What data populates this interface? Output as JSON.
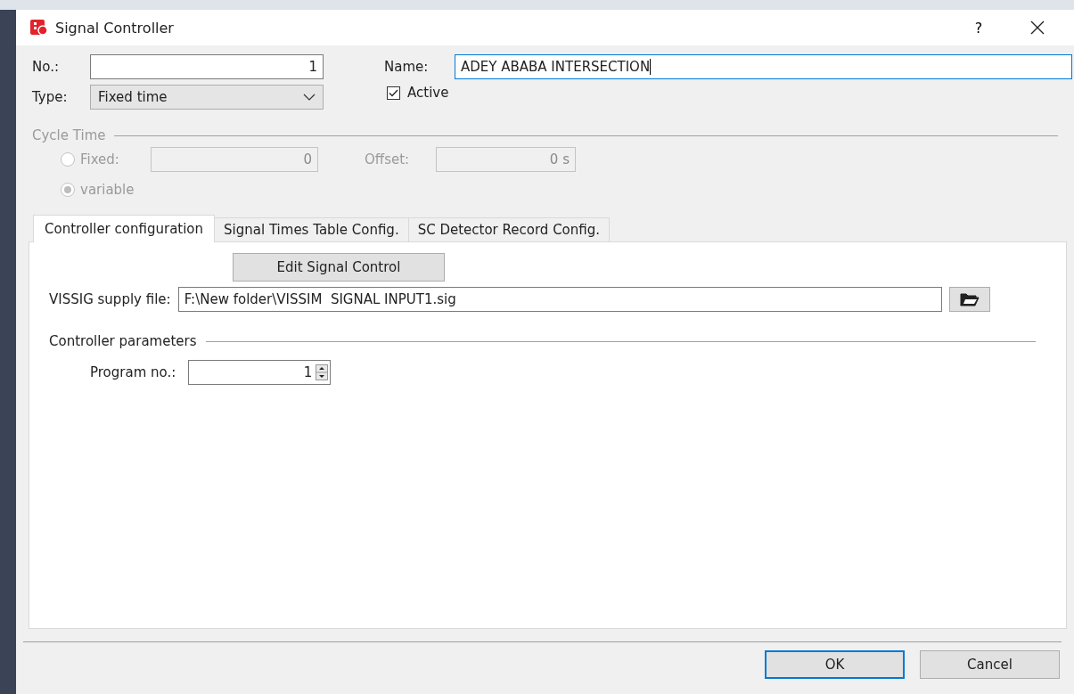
{
  "window": {
    "title": "Signal Controller",
    "help": "?"
  },
  "number": {
    "label": "No.:",
    "value": "1"
  },
  "name": {
    "label": "Name:",
    "value": "ADEY ABABA INTERSECTION"
  },
  "type": {
    "label": "Type:",
    "value": "Fixed time"
  },
  "active": {
    "label": "Active",
    "checked": true
  },
  "cycle_time": {
    "label": "Cycle Time",
    "disabled": true,
    "options": [
      {
        "label": "Fixed:",
        "selected": false,
        "value": "0"
      },
      {
        "label": "variable",
        "selected": true
      }
    ],
    "offset": {
      "label": "Offset:",
      "value": "0 s"
    }
  },
  "tabs": [
    {
      "label": "Controller configuration",
      "selected": true
    },
    {
      "label": "Signal Times Table Config.",
      "selected": false
    },
    {
      "label": "SC Detector Record Config.",
      "selected": false
    }
  ],
  "panel": {
    "edit_button": "Edit Signal Control",
    "supply_file": {
      "label": "VISSIG supply file:",
      "value": "F:\\New folder\\VISSIM  SIGNAL INPUT1.sig"
    },
    "parameters": {
      "label": "Controller parameters",
      "program": {
        "label": "Program no.:",
        "value": "1"
      }
    }
  },
  "buttons": [
    {
      "label": "OK",
      "focused": true
    },
    {
      "label": "Cancel",
      "focused": false
    }
  ]
}
